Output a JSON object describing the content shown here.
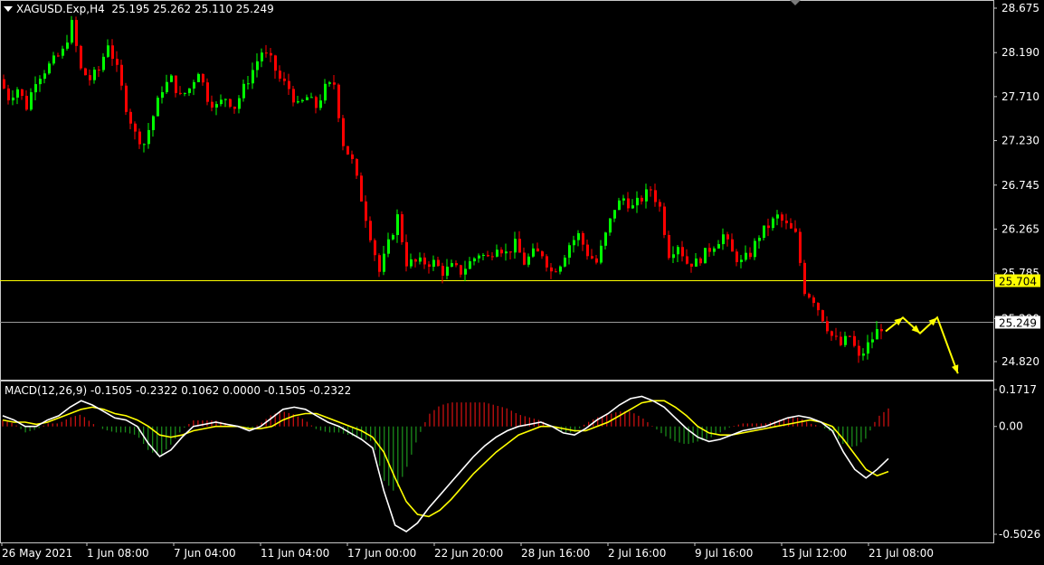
{
  "header": {
    "symbol": "XAGUSD.Exp,H4",
    "ohlc": "25.195 25.262 25.110 25.249"
  },
  "macd": {
    "label": "MACD(12,26,9) -0.1505 -0.2322 0.1062 0.0000 -0.1505 -0.2322"
  },
  "colors": {
    "background": "#000000",
    "bull": "#00ff00",
    "bear": "#ff0000",
    "hline": "#ffff00",
    "current_line": "#9a9a9a",
    "macd_line": "#ffffff",
    "signal_line": "#ffff00",
    "hist_pos": "#c81010",
    "hist_neg": "#1a8a1a",
    "arrow": "#ffff00",
    "axis_text": "#ffffff"
  },
  "chart_data": [
    {
      "type": "candlestick",
      "title": "XAGUSD.Exp,H4",
      "y_ticks": [
        "28.675",
        "28.190",
        "27.710",
        "27.230",
        "26.745",
        "26.265",
        "25.785",
        "25.290",
        "24.820"
      ],
      "x_ticks": [
        "26 May 2021",
        "1 Jun 08:00",
        "7 Jun 04:00",
        "11 Jun 04:00",
        "17 Jun 00:00",
        "22 Jun 20:00",
        "28 Jun 16:00",
        "2 Jul 16:00",
        "9 Jul 16:00",
        "15 Jul 12:00",
        "21 Jul 08:00"
      ],
      "ylim": [
        24.62,
        28.75
      ],
      "horizontal_lines": [
        {
          "label": "25.704",
          "price": 25.704,
          "style": "support"
        },
        {
          "label": "25.249",
          "price": 25.249,
          "style": "current"
        }
      ],
      "projected_path": [
        [
          0,
          25.15
        ],
        [
          0.5,
          25.3
        ],
        [
          1,
          25.13
        ],
        [
          1.5,
          25.3
        ],
        [
          2.1,
          24.69
        ]
      ],
      "path_points": [
        [
          0,
          27.9
        ],
        [
          2,
          27.7
        ],
        [
          4,
          27.8
        ],
        [
          6,
          27.6
        ],
        [
          8,
          27.9
        ],
        [
          10,
          28.0
        ],
        [
          12,
          28.1
        ],
        [
          14,
          28.2
        ],
        [
          16,
          28.5
        ],
        [
          18,
          28.0
        ],
        [
          20,
          27.9
        ],
        [
          22,
          28.0
        ],
        [
          24,
          28.3
        ],
        [
          26,
          28.0
        ],
        [
          28,
          27.6
        ],
        [
          30,
          27.3
        ],
        [
          32,
          27.2
        ],
        [
          34,
          27.5
        ],
        [
          36,
          27.8
        ],
        [
          38,
          27.9
        ],
        [
          40,
          27.7
        ],
        [
          42,
          27.8
        ],
        [
          44,
          28.0
        ],
        [
          46,
          27.7
        ],
        [
          48,
          27.6
        ],
        [
          50,
          27.7
        ],
        [
          52,
          27.6
        ],
        [
          54,
          27.8
        ],
        [
          56,
          28.0
        ],
        [
          58,
          28.2
        ],
        [
          60,
          28.1
        ],
        [
          62,
          27.9
        ],
        [
          64,
          27.8
        ],
        [
          66,
          27.6
        ],
        [
          68,
          27.7
        ],
        [
          70,
          27.6
        ],
        [
          72,
          27.8
        ],
        [
          74,
          27.85
        ],
        [
          76,
          27.2
        ],
        [
          78,
          27.0
        ],
        [
          80,
          26.6
        ],
        [
          82,
          26.2
        ],
        [
          84,
          25.8
        ],
        [
          86,
          26.1
        ],
        [
          88,
          26.4
        ],
        [
          90,
          25.9
        ],
        [
          92,
          25.9
        ],
        [
          94,
          25.9
        ],
        [
          96,
          25.9
        ],
        [
          98,
          25.8
        ],
        [
          100,
          25.85
        ],
        [
          102,
          25.8
        ],
        [
          104,
          25.9
        ],
        [
          106,
          26.0
        ],
        [
          108,
          25.95
        ],
        [
          110,
          26.1
        ],
        [
          112,
          26.0
        ],
        [
          114,
          26.1
        ],
        [
          116,
          25.9
        ],
        [
          118,
          26.0
        ],
        [
          120,
          26.0
        ],
        [
          122,
          25.8
        ],
        [
          124,
          25.9
        ],
        [
          126,
          26.1
        ],
        [
          128,
          26.2
        ],
        [
          130,
          26.0
        ],
        [
          132,
          25.9
        ],
        [
          134,
          26.2
        ],
        [
          136,
          26.5
        ],
        [
          138,
          26.6
        ],
        [
          140,
          26.5
        ],
        [
          142,
          26.6
        ],
        [
          144,
          26.7
        ],
        [
          146,
          26.5
        ],
        [
          148,
          26.0
        ],
        [
          150,
          26.1
        ],
        [
          152,
          25.9
        ],
        [
          154,
          25.9
        ],
        [
          156,
          26.0
        ],
        [
          158,
          26.1
        ],
        [
          160,
          26.2
        ],
        [
          162,
          26.0
        ],
        [
          164,
          25.9
        ],
        [
          166,
          26.0
        ],
        [
          168,
          26.2
        ],
        [
          170,
          26.3
        ],
        [
          172,
          26.4
        ],
        [
          174,
          26.3
        ],
        [
          176,
          26.2
        ],
        [
          178,
          25.6
        ],
        [
          180,
          25.5
        ],
        [
          182,
          25.3
        ],
        [
          184,
          25.1
        ],
        [
          186,
          25.0
        ],
        [
          188,
          25.1
        ],
        [
          190,
          24.85
        ],
        [
          192,
          25.0
        ],
        [
          194,
          25.15
        ],
        [
          196,
          25.25
        ],
        [
          198,
          25.2
        ]
      ]
    },
    {
      "type": "line",
      "title": "MACD(12,26,9)",
      "y_ticks": [
        "0.1717",
        "0.00",
        "-0.5026"
      ],
      "ylim": [
        -0.5026,
        0.1717
      ],
      "series": [
        {
          "name": "main",
          "values": [
            0.05,
            0.03,
            0.0,
            0.0,
            0.03,
            0.05,
            0.09,
            0.12,
            0.1,
            0.07,
            0.04,
            0.03,
            0.0,
            -0.08,
            -0.14,
            -0.11,
            -0.05,
            0.0,
            0.01,
            0.02,
            0.01,
            0.0,
            -0.02,
            0.0,
            0.04,
            0.08,
            0.09,
            0.08,
            0.05,
            0.02,
            0.0,
            -0.03,
            -0.06,
            -0.1,
            -0.3,
            -0.46,
            -0.49,
            -0.45,
            -0.38,
            -0.32,
            -0.26,
            -0.2,
            -0.14,
            -0.09,
            -0.05,
            -0.02,
            0.0,
            0.01,
            0.02,
            0.0,
            -0.03,
            -0.04,
            -0.01,
            0.03,
            0.06,
            0.1,
            0.13,
            0.14,
            0.12,
            0.09,
            0.04,
            -0.01,
            -0.05,
            -0.07,
            -0.06,
            -0.04,
            -0.02,
            -0.01,
            0.0,
            0.02,
            0.04,
            0.05,
            0.04,
            0.02,
            -0.02,
            -0.12,
            -0.2,
            -0.24,
            -0.2,
            -0.15
          ]
        },
        {
          "name": "signal",
          "values": [
            0.03,
            0.02,
            0.02,
            0.01,
            0.02,
            0.04,
            0.06,
            0.08,
            0.09,
            0.08,
            0.06,
            0.05,
            0.03,
            0.0,
            -0.04,
            -0.05,
            -0.04,
            -0.02,
            -0.01,
            0.0,
            0.0,
            0.0,
            -0.01,
            -0.01,
            0.0,
            0.03,
            0.05,
            0.06,
            0.06,
            0.04,
            0.02,
            0.0,
            -0.02,
            -0.05,
            -0.12,
            -0.24,
            -0.35,
            -0.41,
            -0.42,
            -0.39,
            -0.34,
            -0.28,
            -0.22,
            -0.17,
            -0.12,
            -0.08,
            -0.04,
            -0.02,
            0.0,
            0.0,
            -0.01,
            -0.02,
            -0.02,
            0.0,
            0.02,
            0.05,
            0.08,
            0.11,
            0.12,
            0.12,
            0.09,
            0.05,
            0.0,
            -0.03,
            -0.04,
            -0.04,
            -0.03,
            -0.02,
            -0.01,
            0.0,
            0.01,
            0.02,
            0.03,
            0.02,
            0.0,
            -0.06,
            -0.13,
            -0.2,
            -0.23,
            -0.21
          ]
        }
      ]
    }
  ]
}
